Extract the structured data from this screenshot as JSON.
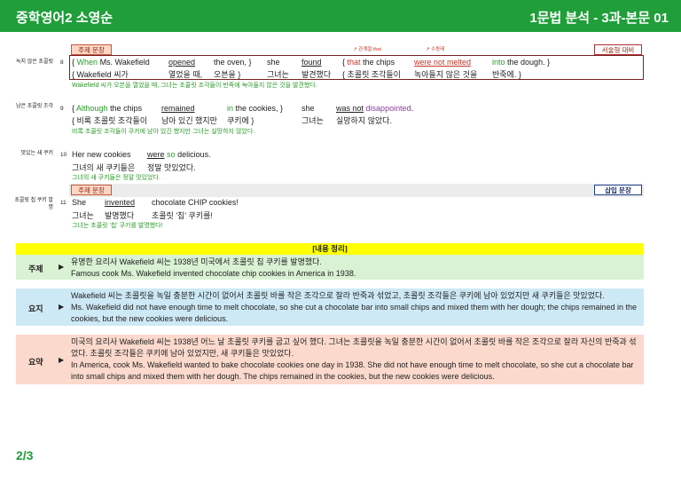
{
  "header": {
    "left_title": "중학영어2 소영순",
    "right_title": "1문법 분석 - 3과-본문 01"
  },
  "tags": {
    "theme_sentence": "주제 문장",
    "descriptive": "서술형 대비",
    "insert_sentence": "삽입 문장"
  },
  "notes": {
    "relative_that": "관계절 that",
    "passive": "수동태"
  },
  "sentences": [
    {
      "side": "녹지 않은 초콜릿",
      "num": "8",
      "en": {
        "brace_open": "{",
        "when": "When",
        "subj": "Ms. Wakefield",
        "verb": "opened",
        "obj": "the oven, }",
        "s2": "she",
        "v2": "found",
        "b2": "{",
        "that": "that",
        "c2": "the chips",
        "passive": "were not melted",
        "into": "into",
        "rest": "the dough. }"
      },
      "ko": {
        "a": "{ Wakefield 씨가",
        "b": "열었을 때,",
        "c": "오븐을 }",
        "d": "그녀는",
        "e": "발견했다",
        "f": "{ 초콜릿 조각들이",
        "g": "녹아들지 않은 것을",
        "h": "반죽에. }"
      },
      "tr": "Wakefield 씨가 오븐을 열었을 때, 그녀는 초콜릿 조각들이 반죽에 녹아들지 않은 것을 발견했다."
    },
    {
      "side": "남은 초콜릿 조각",
      "num": "9",
      "en": {
        "b": "{",
        "although": "Although",
        "subj": "the chips",
        "verb": "remained",
        "in": "in",
        "rest": "the cookies, }",
        "s2": "she",
        "v2": "was not",
        "adj": "disappointed",
        "dot": "."
      },
      "ko": {
        "a": "{ 비록 초콜릿 조각들이",
        "b": "남아 있긴 했지만",
        "c": "쿠키에 }",
        "d": "그녀는",
        "e": "실망하지 않았다."
      },
      "tr": "비록 초콜릿 조각들이 쿠키에 남아 있긴 했지만 그녀는 실망하지 않았다."
    },
    {
      "side": "맛있는 새 쿠키",
      "num": "10",
      "en": {
        "subj": "Her new cookies",
        "verb": "were",
        "so": "so",
        "rest": "delicious."
      },
      "ko": {
        "a": "그녀의 새 쿠키들은",
        "b": "정말 맛있었다."
      },
      "tr": "그녀의 새 쿠키들은 정말 맛있었다."
    },
    {
      "side": "초콜릿 칩 쿠키 발명",
      "num": "11",
      "en": {
        "subj": "She",
        "verb": "invented",
        "rest": "chocolate CHIP cookies!"
      },
      "ko": {
        "a": "그녀는",
        "b": "발명했다",
        "c": "초콜릿 '칩' 쿠키를!"
      },
      "tr": "그녀는 초콜릿 '칩' 쿠키를 발명했다!"
    }
  ],
  "summary": {
    "heading": "[내용 정리]",
    "theme": {
      "label": "주제",
      "arrow": "▶",
      "ko": "유명한 요리사 Wakefield 씨는 1938년 미국에서 초콜릿 칩 쿠키를 발명했다.",
      "en": "Famous cook Ms. Wakefield invented chocolate chip cookies in America in 1938."
    },
    "gist": {
      "label": "요지",
      "arrow": "▶",
      "ko": "Wakefield 씨는 초콜릿을 녹일 충분한 시간이 없어서 초콜릿 바를 작은 조각으로 잘라 반죽과 섞었고, 초콜릿 조각들은 쿠키에 남아 있었지만 새 쿠키들은 맛있었다.",
      "en": "Ms. Wakefield did not have enough time to melt chocolate, so she cut a chocolate bar into small chips and mixed them with her dough; the chips remained in the cookies, but the new cookies were delicious."
    },
    "sum": {
      "label": "요약",
      "arrow": "▶",
      "ko": "미국의 요리사 Wakefield 씨는 1938년 어느 날 초콜릿 쿠키를 굽고 싶어 했다. 그녀는 초콜릿을 녹일 충분한 시간이 없어서 초콜릿 바를 작은 조각으로 잘라 자신의 반죽과 섞었다. 초콜릿 조각들은 쿠키에 남아 있었지만, 새 쿠키들은 맛있었다.",
      "en": "In America, cook Ms. Wakefield wanted to bake chocolate cookies one day in 1938. She did not have enough time to melt chocolate, so she cut a chocolate bar into small chips and mixed them with her dough. The chips remained in the cookies, but the new cookies were delicious."
    }
  },
  "page": "2/3"
}
